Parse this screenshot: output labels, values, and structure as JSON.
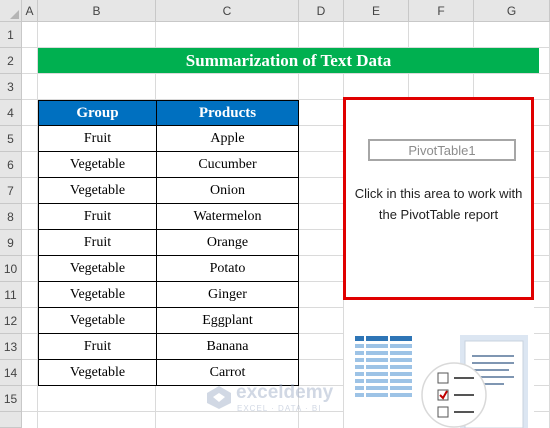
{
  "columns": [
    "A",
    "B",
    "C",
    "D",
    "E",
    "F",
    "G"
  ],
  "rows": [
    "1",
    "2",
    "3",
    "4",
    "5",
    "6",
    "7",
    "8",
    "9",
    "10",
    "11",
    "12",
    "13",
    "14",
    "15"
  ],
  "title": "Summarization of Text Data",
  "table": {
    "headers": [
      "Group",
      "Products"
    ],
    "rows": [
      [
        "Fruit",
        "Apple"
      ],
      [
        "Vegetable",
        "Cucumber"
      ],
      [
        "Vegetable",
        "Onion"
      ],
      [
        "Fruit",
        "Watermelon"
      ],
      [
        "Fruit",
        "Orange"
      ],
      [
        "Vegetable",
        "Potato"
      ],
      [
        "Vegetable",
        "Ginger"
      ],
      [
        "Vegetable",
        "Eggplant"
      ],
      [
        "Fruit",
        "Banana"
      ],
      [
        "Vegetable",
        "Carrot"
      ]
    ]
  },
  "pivot": {
    "name": "PivotTable1",
    "message_line1": "Click in this area to work with",
    "message_line2": "the PivotTable report"
  },
  "watermark": {
    "name": "exceldemy",
    "tagline": "EXCEL · DATA · BI"
  },
  "colors": {
    "title_bg": "#00b050",
    "table_header_bg": "#0070c0",
    "highlight_border": "#e00000"
  },
  "icons": [
    "field-list-grid-icon",
    "report-layout-icon",
    "checklist-icon",
    "exceldemy-logo-icon"
  ]
}
